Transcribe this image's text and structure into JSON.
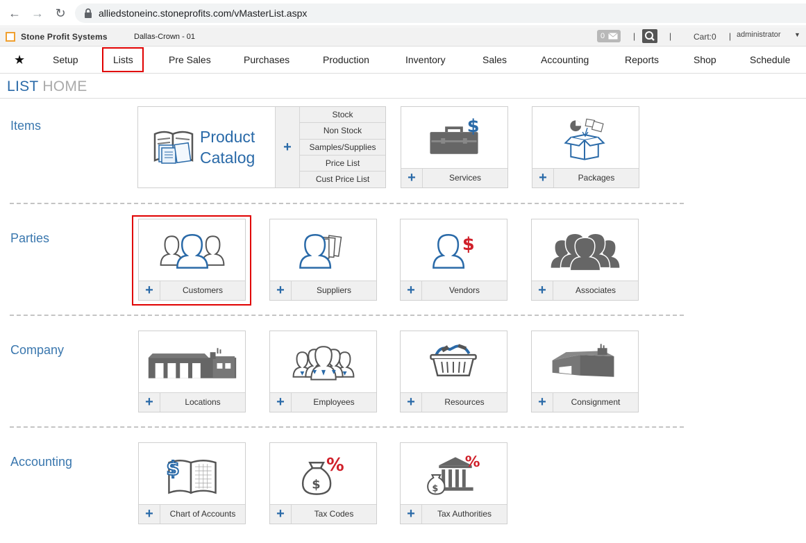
{
  "browser": {
    "url": "alliedstoneinc.stoneprofits.com/vMasterList.aspx"
  },
  "header": {
    "brand": "Stone Profit Systems",
    "location": "Dallas-Crown - 01",
    "mail_count": "0",
    "separator": "|",
    "cart": "Cart:0",
    "user": "administrator"
  },
  "nav": {
    "items": [
      "Setup",
      "Lists",
      "Pre Sales",
      "Purchases",
      "Production",
      "Inventory",
      "Sales",
      "Accounting",
      "Reports",
      "Shop",
      "Schedule"
    ]
  },
  "page": {
    "title_a": "LIST",
    "title_b": "HOME"
  },
  "plus": "+",
  "sections": {
    "items": {
      "label": "Items",
      "catalog": {
        "title_line1": "Product",
        "title_line2": "Catalog",
        "links": [
          "Stock",
          "Non Stock",
          "Samples/Supplies",
          "Price List",
          "Cust Price List"
        ]
      },
      "tiles": [
        "Services",
        "Packages"
      ]
    },
    "parties": {
      "label": "Parties",
      "tiles": [
        "Customers",
        "Suppliers",
        "Vendors",
        "Associates"
      ]
    },
    "company": {
      "label": "Company",
      "tiles": [
        "Locations",
        "Employees",
        "Resources",
        "Consignment"
      ]
    },
    "accounting": {
      "label": "Accounting",
      "tiles": [
        "Chart of Accounts",
        "Tax Codes",
        "Tax Authorities"
      ]
    }
  },
  "colors": {
    "accent_blue": "#2a6aa8",
    "icon_gray": "#666666",
    "highlight_red": "#e00000",
    "percent_red": "#d0202a"
  }
}
